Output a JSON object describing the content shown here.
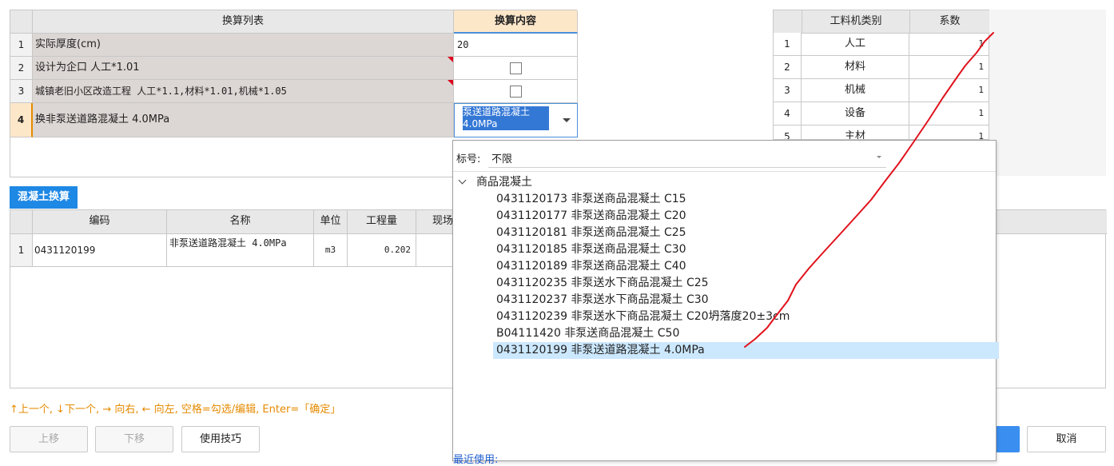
{
  "top_table": {
    "col1_header": "换算列表",
    "col2_header": "换算内容",
    "rows": [
      {
        "num": "1",
        "name": "实际厚度(cm)",
        "value": "20"
      },
      {
        "num": "2",
        "name": "设计为企口 人工*1.01"
      },
      {
        "num": "3",
        "name": "城镇老旧小区改造工程 人工*1.1,材料*1.01,机械*1.05"
      },
      {
        "num": "4",
        "name": "换非泵送道路混凝土 4.0MPa",
        "value": "泵送道路混凝土 4.0MPa"
      }
    ]
  },
  "coef_table": {
    "col1_header": "工料机类别",
    "col2_header": "系数",
    "rows": [
      {
        "num": "1",
        "category": "人工",
        "coef": "1"
      },
      {
        "num": "2",
        "category": "材料",
        "coef": "1"
      },
      {
        "num": "3",
        "category": "机械",
        "coef": "1"
      },
      {
        "num": "4",
        "category": "设备",
        "coef": "1"
      },
      {
        "num": "5",
        "category": "主材",
        "coef": "1"
      }
    ]
  },
  "concrete_tab": {
    "label": "混凝土换算"
  },
  "bottom_table": {
    "headers": [
      "编码",
      "名称",
      "单位",
      "工程量",
      "现场"
    ],
    "rows": [
      {
        "num": "1",
        "code": "0431120199",
        "name": "非泵送道路混凝土 4.0MPa",
        "unit": "m3",
        "qty": "0.202"
      }
    ]
  },
  "hint": "↑上一个, ↓下一个, → 向右, ← 向左, 空格=勾选/编辑, Enter=「确定」",
  "buttons": {
    "up": "上移",
    "down": "下移",
    "tips": "使用技巧",
    "cancel": "取消"
  },
  "dropdown": {
    "filter_label": "标号:",
    "filter_value": "不限",
    "group": "商品混凝土",
    "items": [
      "0431120173  非泵送商品混凝土 C15",
      "0431120177  非泵送商品混凝土 C20",
      "0431120181  非泵送商品混凝土 C25",
      "0431120185  非泵送商品混凝土 C30",
      "0431120189  非泵送商品混凝土 C40",
      "0431120235  非泵送水下商品混凝土 C25",
      "0431120237  非泵送水下商品混凝土 C30",
      "0431120239  非泵送水下商品混凝土 C20坍落度20±3cm",
      "B04111420  非泵送商品混凝土 C50",
      "0431120199  非泵送道路混凝土 4.0MPa"
    ],
    "selected_index": 9,
    "recent_label": "最近使用:"
  },
  "colors": {
    "accent": "#1e88e5",
    "hint": "#e58a00",
    "selected": "#cce8ff",
    "header_highlight": "#fde7c9"
  }
}
